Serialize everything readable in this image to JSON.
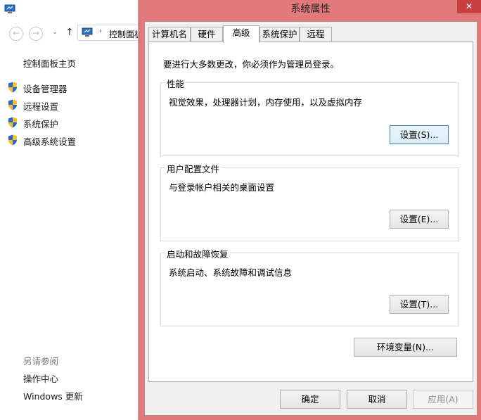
{
  "control_panel": {
    "address": "控制面板",
    "nav_items": [
      {
        "label": "控制面板主页"
      },
      {
        "label": "设备管理器"
      },
      {
        "label": "远程设置"
      },
      {
        "label": "系统保护"
      },
      {
        "label": "高级系统设置"
      }
    ],
    "see_also": {
      "heading": "另请参阅",
      "items": [
        {
          "label": "操作中心"
        },
        {
          "label": "Windows 更新"
        }
      ]
    }
  },
  "dialog": {
    "title": "系统属性",
    "close_glyph": "✕",
    "tabs": [
      {
        "label": "计算机名"
      },
      {
        "label": "硬件"
      },
      {
        "label": "高级"
      },
      {
        "label": "系统保护"
      },
      {
        "label": "远程"
      }
    ],
    "active_tab": "高级",
    "admin_notice": "要进行大多数更改，你必须作为管理员登录。",
    "performance": {
      "label": "性能",
      "description": "视觉效果，处理器计划，内存使用，以及虚拟内存",
      "button": "设置(S)..."
    },
    "user_profiles": {
      "label": "用户配置文件",
      "description": "与登录帐户相关的桌面设置",
      "button": "设置(E)..."
    },
    "startup_recovery": {
      "label": "启动和故障恢复",
      "description": "系统启动、系统故障和调试信息",
      "button": "设置(T)..."
    },
    "env_button": "环境变量(N)...",
    "ok_button": "确定",
    "cancel_button": "取消",
    "apply_button": "应用(A)"
  },
  "colors": {
    "dialog_frame": "#e27a7b",
    "close_button": "#c7403f",
    "focus_border": "#3c7fb1"
  },
  "icons": {
    "nav_items": "uac-shield-icon",
    "app": "computer-icon"
  }
}
